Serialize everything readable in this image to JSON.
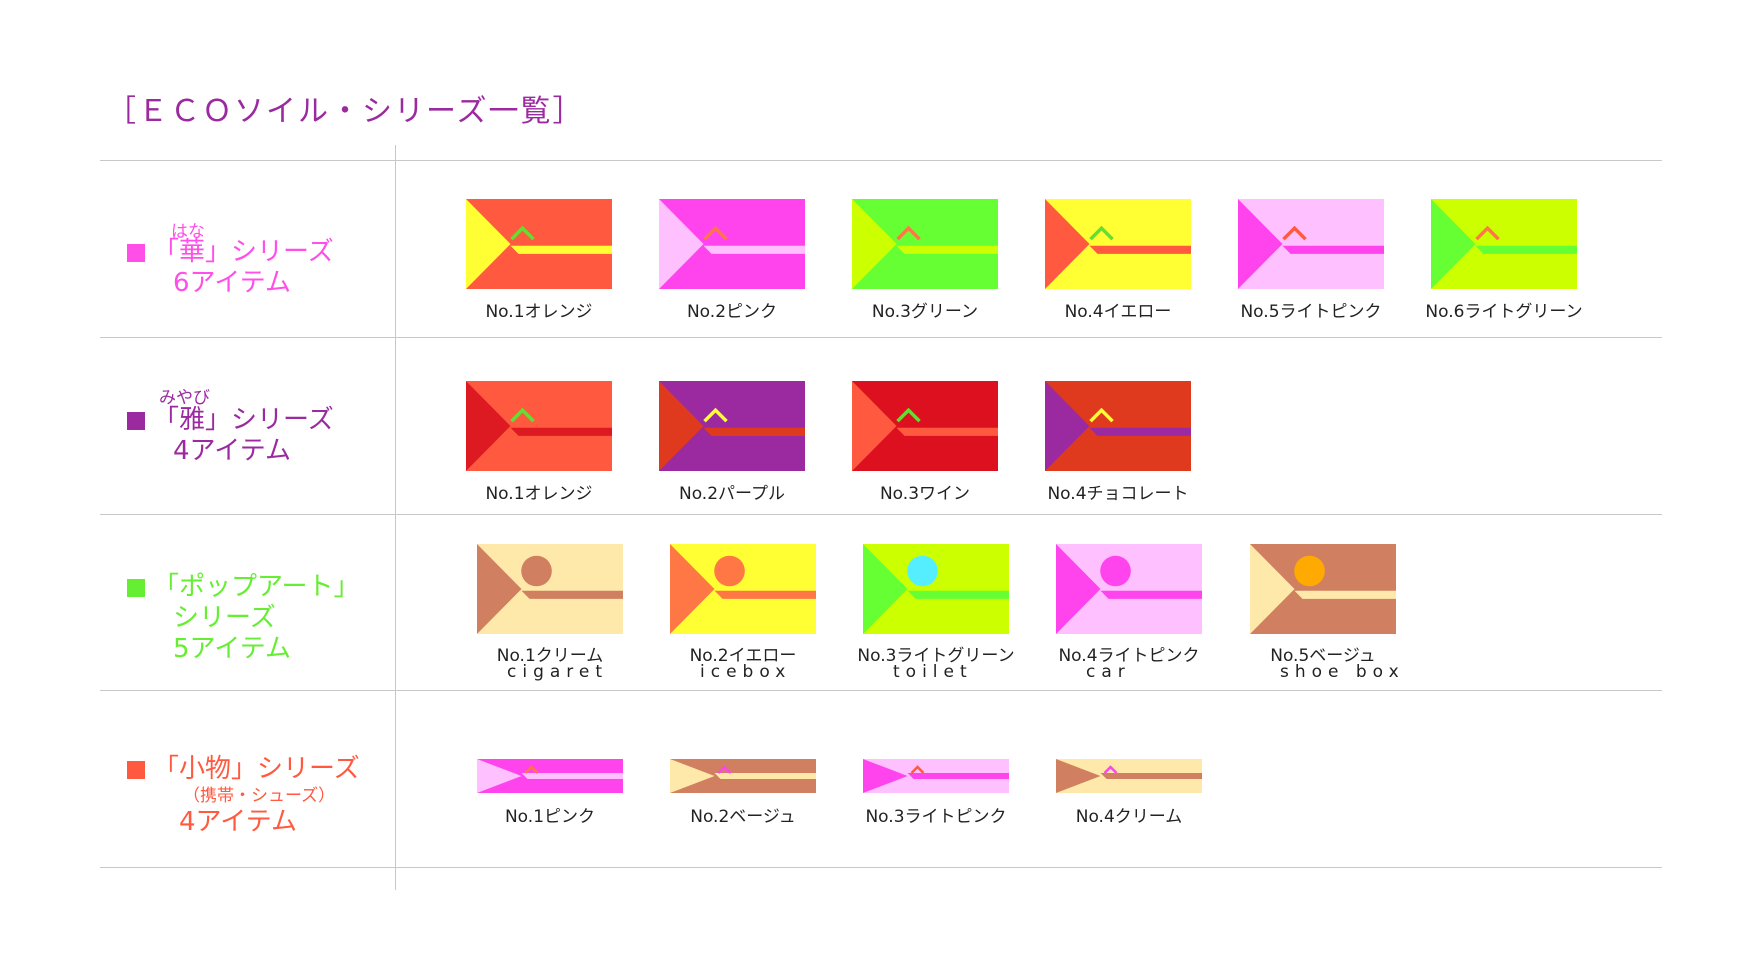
{
  "title": "［ＥＣＯソイル・シリーズ一覧］",
  "series": [
    {
      "ruby": "はな",
      "name": "「華」シリーズ",
      "count": "6アイテム",
      "color": "#ff4fe8",
      "kind": "arrow",
      "items": [
        {
          "label": "No.1オレンジ",
          "bg": "#ff5a40",
          "tri": "#ffff33",
          "stripe": "#ffff33",
          "mark": "#66dd33"
        },
        {
          "label": "No.2ピンク",
          "bg": "#ff44ee",
          "tri": "#ffc0ff",
          "stripe": "#ffc0ff",
          "mark": "#ff7744"
        },
        {
          "label": "No.3グリーン",
          "bg": "#66ff33",
          "tri": "#ccff00",
          "stripe": "#ccff00",
          "mark": "#ff7744"
        },
        {
          "label": "No.4イエロー",
          "bg": "#ffff33",
          "tri": "#ff5a40",
          "stripe": "#ff5a40",
          "mark": "#66dd33"
        },
        {
          "label": "No.5ライトピンク",
          "bg": "#ffc0ff",
          "tri": "#ff44ee",
          "stripe": "#ff44ee",
          "mark": "#ff5a40"
        },
        {
          "label": "No.6ライトグリーン",
          "bg": "#ccff00",
          "tri": "#66ff33",
          "stripe": "#66ff33",
          "mark": "#ff7744"
        }
      ]
    },
    {
      "ruby": "みやび",
      "name": "「雅」シリーズ",
      "count": "4アイテム",
      "color": "#9b2aa0",
      "kind": "arrow",
      "items": [
        {
          "label": "No.1オレンジ",
          "bg": "#ff5a40",
          "tri": "#dd1a22",
          "stripe": "#dd1a22",
          "mark": "#66dd33"
        },
        {
          "label": "No.2パープル",
          "bg": "#9b2aa0",
          "tri": "#e03a1e",
          "stripe": "#e03a1e",
          "mark": "#ffff33"
        },
        {
          "label": "No.3ワイン",
          "bg": "#dd1020",
          "tri": "#ff5a40",
          "stripe": "#ff5a40",
          "mark": "#66dd33"
        },
        {
          "label": "No.4チョコレート",
          "bg": "#e03a1e",
          "tri": "#9b2aa0",
          "stripe": "#9b2aa0",
          "mark": "#ffff33"
        }
      ]
    },
    {
      "ruby": "",
      "name": "「ポップアート」",
      "name2": "シリーズ",
      "count": "5アイテム",
      "color": "#66ee33",
      "kind": "circle",
      "items": [
        {
          "label": "No.1クリーム",
          "sub": "cigaret",
          "bg": "#ffe9aa",
          "tri": "#d08060",
          "stripe": "#d08060",
          "mark": "#d08060"
        },
        {
          "label": "No.2イエロー",
          "sub": "icebox",
          "bg": "#ffff33",
          "tri": "#ff7744",
          "stripe": "#ff7744",
          "mark": "#ff7744"
        },
        {
          "label": "No.3ライトグリーン",
          "sub": "toilet",
          "bg": "#ccff00",
          "tri": "#66ff33",
          "stripe": "#66ff33",
          "mark": "#55eeff"
        },
        {
          "label": "No.4ライトピンク",
          "sub": "car",
          "bg": "#ffc0ff",
          "tri": "#ff44ee",
          "stripe": "#ff44ee",
          "mark": "#ff44ee"
        },
        {
          "label": "No.5ベージュ",
          "sub": "shoe box",
          "bg": "#d08060",
          "tri": "#ffe9aa",
          "stripe": "#ffe9aa",
          "mark": "#ffaa00"
        }
      ]
    },
    {
      "ruby": "",
      "name": "「小物」シリーズ",
      "note": "（携帯・シューズ）",
      "count": "4アイテム",
      "color": "#ff5a40",
      "kind": "small",
      "items": [
        {
          "label": "No.1ピンク",
          "bg": "#ff44ee",
          "tri": "#ffc0ff",
          "stripe": "#ffc0ff",
          "mark": "#ff7744"
        },
        {
          "label": "No.2ベージュ",
          "bg": "#d08060",
          "tri": "#ffe9aa",
          "stripe": "#ffe9aa",
          "mark": "#ff44ee"
        },
        {
          "label": "No.3ライトピンク",
          "bg": "#ffc0ff",
          "tri": "#ff44ee",
          "stripe": "#ff44ee",
          "mark": "#ff5a40"
        },
        {
          "label": "No.4クリーム",
          "bg": "#ffe9aa",
          "tri": "#d08060",
          "stripe": "#d08060",
          "mark": "#ff44ee"
        }
      ]
    }
  ]
}
